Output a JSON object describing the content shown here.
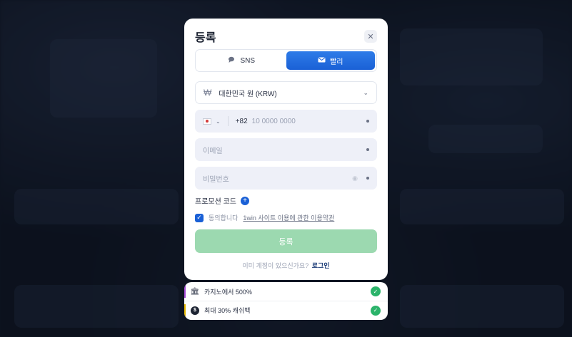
{
  "modal": {
    "title": "등록",
    "close_icon": "close-icon"
  },
  "tabs": [
    {
      "label": "SNS",
      "icon": "chat-bubble-icon",
      "active": false
    },
    {
      "label": "빨리",
      "icon": "envelope-icon",
      "active": true
    }
  ],
  "currency": {
    "symbol": "₩",
    "value": "대한민국 원 (KRW)"
  },
  "phone": {
    "country_code": "+82",
    "placeholder": "10 0000 0000"
  },
  "email": {
    "placeholder": "이메일"
  },
  "password": {
    "placeholder": "비밀번호"
  },
  "promo": {
    "label": "프로모션 코드"
  },
  "agreement": {
    "prefix": "동의합니다",
    "link_text": "1win 사이트 이용에 관한 이용약관",
    "checked": true
  },
  "submit": {
    "label": "등록"
  },
  "login": {
    "prompt": "이미 계정이 있으신가요?",
    "link": "로그인"
  },
  "bonuses": [
    {
      "label": "카지노에서 500%",
      "icon": "bank-icon",
      "stripe_color": "#a64bd6"
    },
    {
      "label": "최대 30% 캐쉬백",
      "icon": "coin-icon",
      "stripe_color": "#e6b800"
    }
  ],
  "colors": {
    "accent": "#1a60d6",
    "submit_disabled": "#9cd9b0",
    "check_green": "#2bb36a"
  }
}
